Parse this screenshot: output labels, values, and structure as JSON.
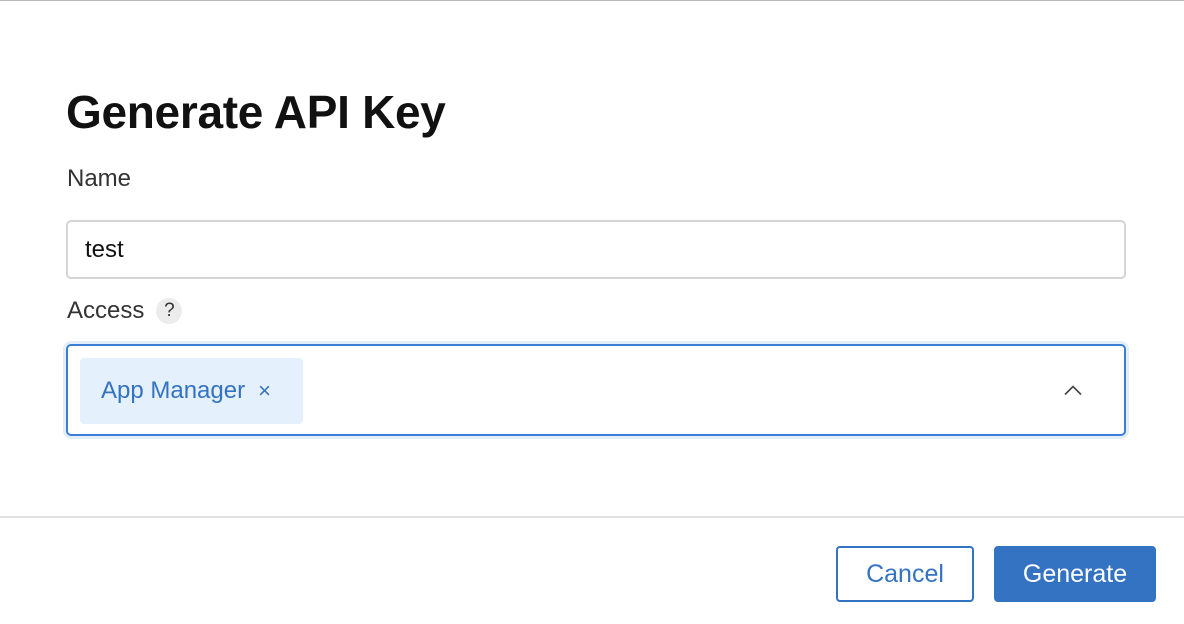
{
  "dialog": {
    "title": "Generate API Key"
  },
  "name_field": {
    "label": "Name",
    "value": "test"
  },
  "access_field": {
    "label": "Access",
    "help_glyph": "?",
    "selected_tags": [
      {
        "label": "App Manager",
        "remove_glyph": "×"
      }
    ],
    "dropdown_state": "expanded"
  },
  "buttons": {
    "cancel_label": "Cancel",
    "generate_label": "Generate"
  },
  "colors": {
    "accent": "#3472c2",
    "tag_background": "#e4f0fc",
    "focus_border": "#3d7fd6"
  },
  "icons": {
    "help": "help-icon",
    "tag_remove": "close-icon",
    "dropdown": "chevron-up-icon"
  }
}
